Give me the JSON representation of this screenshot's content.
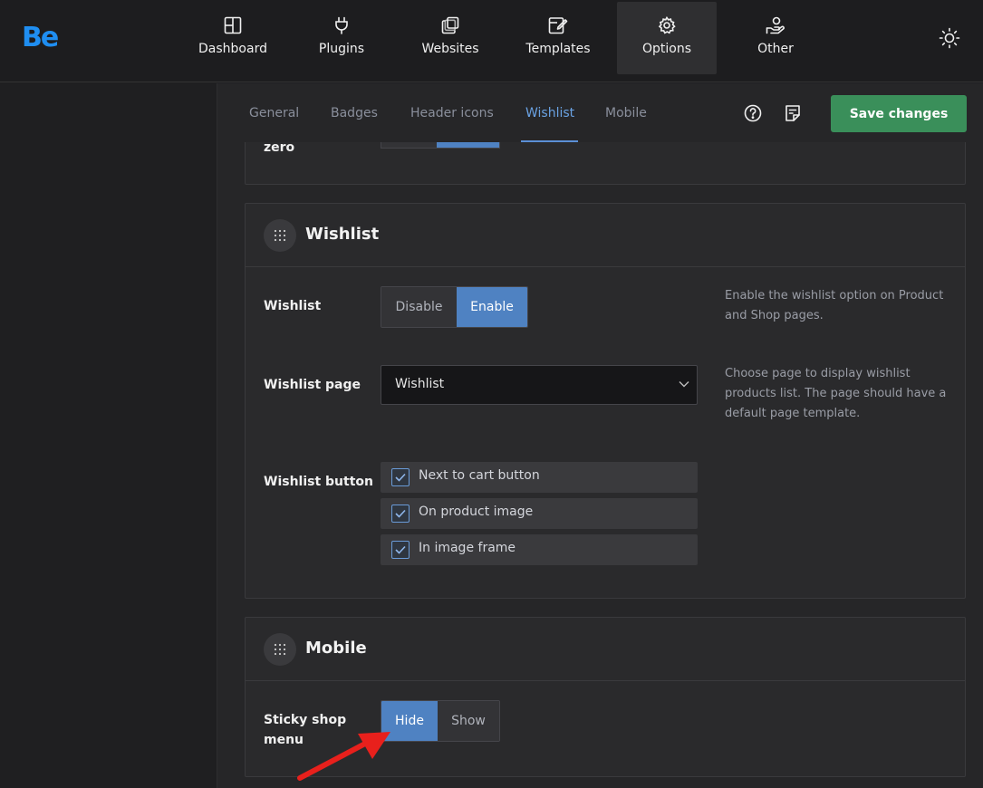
{
  "app": {
    "logo": "Be",
    "logo_color": "#1f8ef1"
  },
  "nav": [
    {
      "label": "Dashboard",
      "icon": "dashboard-icon"
    },
    {
      "label": "Plugins",
      "icon": "plug-icon"
    },
    {
      "label": "Websites",
      "icon": "websites-icon"
    },
    {
      "label": "Templates",
      "icon": "templates-icon"
    },
    {
      "label": "Options",
      "icon": "gear-icon",
      "active": true
    },
    {
      "label": "Other",
      "icon": "hand-user-icon"
    }
  ],
  "tabs": [
    {
      "label": "General"
    },
    {
      "label": "Badges"
    },
    {
      "label": "Header icons"
    },
    {
      "label": "Wishlist",
      "active": true
    },
    {
      "label": "Mobile"
    }
  ],
  "toolbar": {
    "save_label": "Save changes",
    "help_icon": "help-icon",
    "notes_icon": "notes-icon"
  },
  "prev_panel": {
    "partial_label": "zero"
  },
  "wishlist_panel": {
    "title": "Wishlist",
    "wishlist_toggle": {
      "label": "Wishlist",
      "options": [
        "Disable",
        "Enable"
      ],
      "selected": "Enable",
      "description": "Enable the wishlist option on Product and Shop pages."
    },
    "wishlist_page": {
      "label": "Wishlist page",
      "value": "Wishlist",
      "description": "Choose page to display wishlist products list. The page should have a default page template."
    },
    "wishlist_button": {
      "label": "Wishlist button",
      "options": [
        {
          "label": "Next to cart button",
          "checked": true
        },
        {
          "label": "On product image",
          "checked": true
        },
        {
          "label": "In image frame",
          "checked": true
        }
      ]
    }
  },
  "mobile_panel": {
    "title": "Mobile",
    "sticky_shop_menu": {
      "label": "Sticky shop menu",
      "options": [
        "Hide",
        "Show"
      ],
      "selected": "Hide"
    }
  },
  "colors": {
    "accent": "#4f82c2",
    "save": "#3a8f5a",
    "arrow": "#e8201c"
  }
}
